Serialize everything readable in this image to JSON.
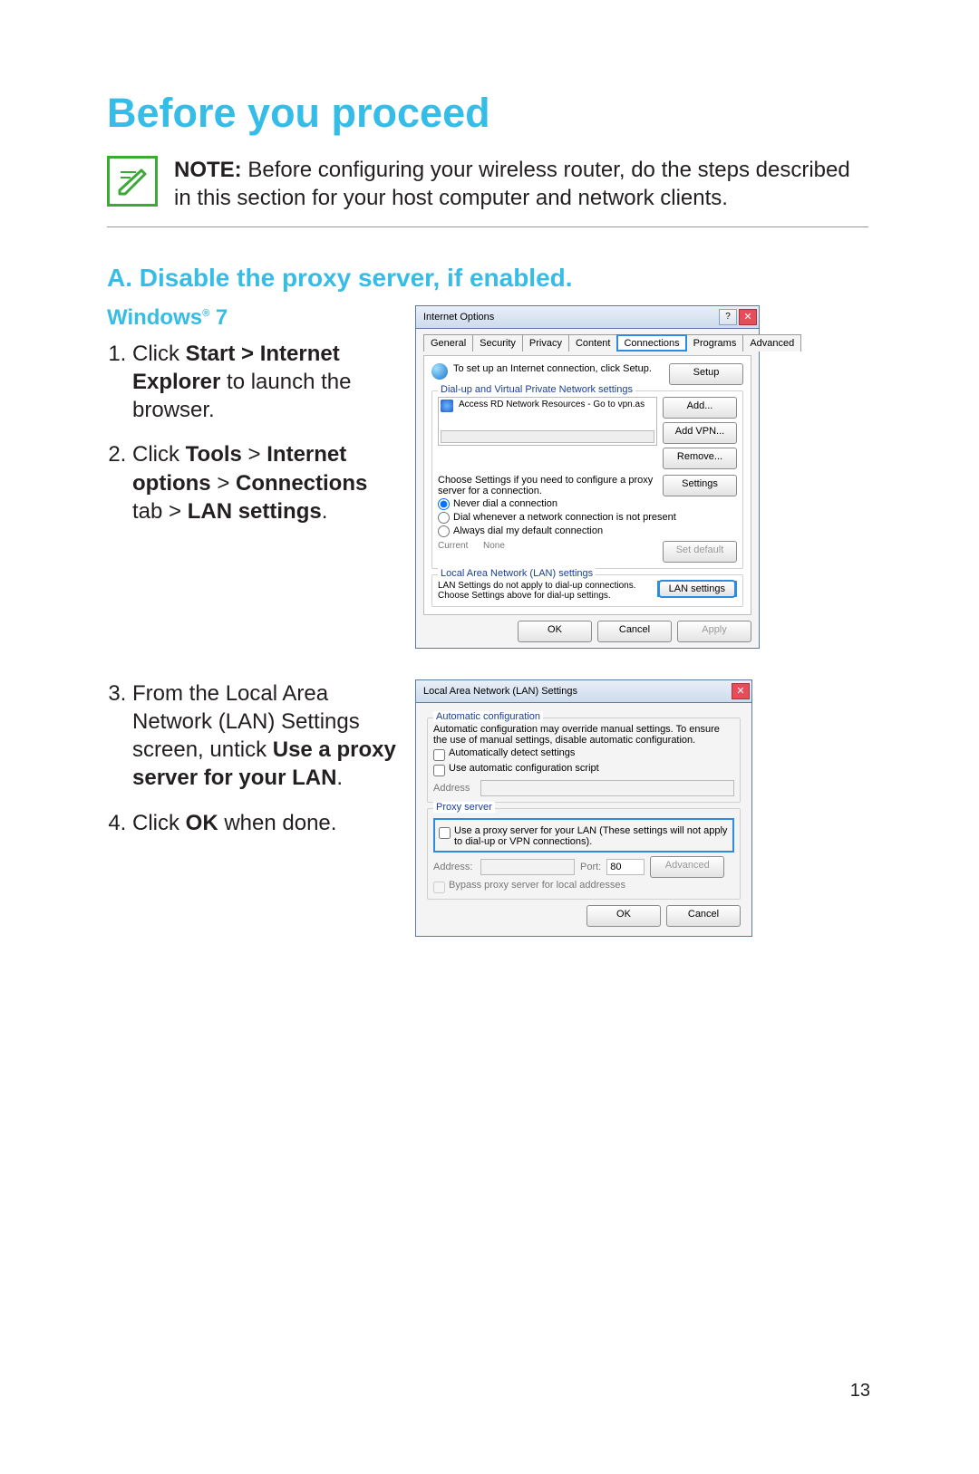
{
  "page_title": "Before you proceed",
  "note_prefix": "NOTE:",
  "note_body": "  Before configuring your wireless router, do the steps described in this section for your host computer and network clients.",
  "section_a": "A.   Disable the proxy server, if enabled.",
  "os_heading_prefix": "Windows",
  "os_heading_suffix": " 7",
  "steps1": {
    "s1a": "Click ",
    "s1b": "Start > Internet Explorer",
    "s1c": " to launch the browser.",
    "s2a": "Click ",
    "s2b": "Tools",
    "s2c": " > ",
    "s2d": "Internet options ",
    "s2e": "> ",
    "s2f": "Connections",
    "s2g": " tab > ",
    "s2h": "LAN settings",
    "s2i": "."
  },
  "steps2": {
    "s3a": "From the Local Area Network (LAN) Settings screen, untick ",
    "s3b": "Use a proxy server for your LAN",
    "s3c": ".",
    "s4a": "Click ",
    "s4b": "OK",
    "s4c": " when done."
  },
  "page_number": "13",
  "io": {
    "title": "Internet Options",
    "tabs": [
      "General",
      "Security",
      "Privacy",
      "Content",
      "Connections",
      "Programs",
      "Advanced"
    ],
    "intro": "To set up an Internet connection, click Setup.",
    "setup": "Setup",
    "dvpn": "Dial-up and Virtual Private Network settings",
    "item": "Access RD Network Resources - Go to vpn.as",
    "add": "Add...",
    "addvpn": "Add VPN...",
    "remove": "Remove...",
    "choose": "Choose Settings if you need to configure a proxy server for a connection.",
    "settings": "Settings",
    "r1": "Never dial a connection",
    "r2": "Dial whenever a network connection is not present",
    "r3": "Always dial my default connection",
    "current": "Current",
    "none": "None",
    "setdef": "Set default",
    "lan_group": "Local Area Network (LAN) settings",
    "lan_hint": "LAN Settings do not apply to dial-up connections. Choose Settings above for dial-up settings.",
    "lan_btn": "LAN settings",
    "ok": "OK",
    "cancel": "Cancel",
    "apply": "Apply"
  },
  "lan": {
    "title": "Local Area Network (LAN) Settings",
    "auto_group": "Automatic configuration",
    "auto_hint": "Automatic configuration may override manual settings. To ensure the use of manual settings, disable automatic configuration.",
    "auto_detect": "Automatically detect settings",
    "auto_script": "Use automatic configuration script",
    "address": "Address",
    "proxy_group": "Proxy server",
    "proxy_use": "Use a proxy server for your LAN (These settings will not apply to dial-up or VPN connections).",
    "address2": "Address:",
    "port": "Port:",
    "port_val": "80",
    "advanced": "Advanced",
    "bypass": "Bypass proxy server for local addresses",
    "ok": "OK",
    "cancel": "Cancel"
  }
}
